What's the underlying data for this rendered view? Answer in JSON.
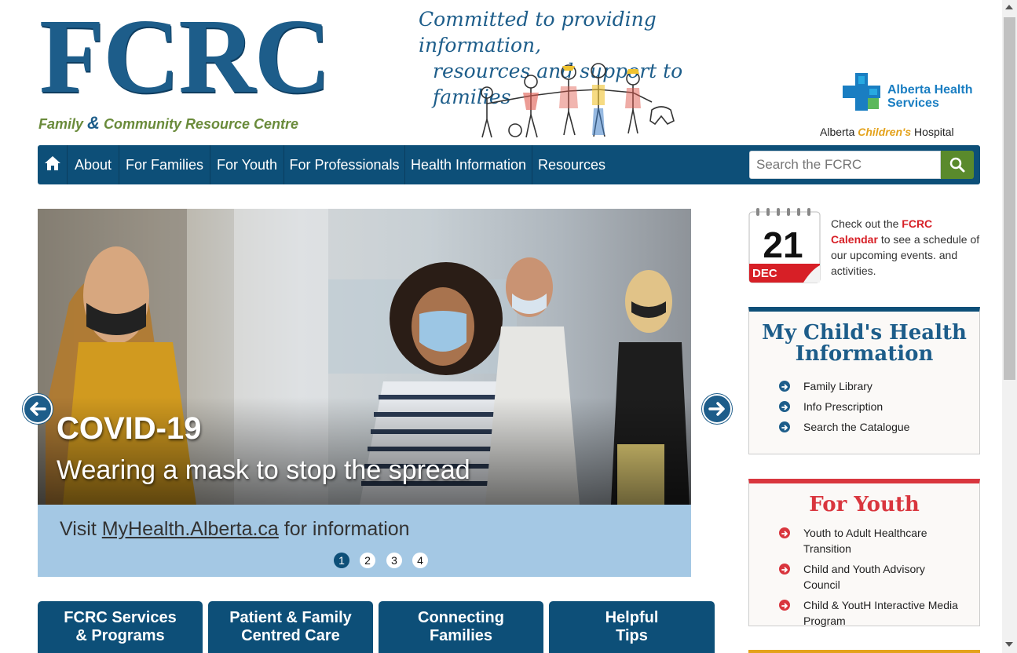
{
  "header": {
    "logo": "FCRC",
    "tagline_part1": "Family",
    "tagline_amp": "&",
    "tagline_part2": "Community Resource Centre",
    "slogan_line1": "Committed to providing information,",
    "slogan_line2": "resources and support to families",
    "ahs_line1": "Alberta Health",
    "ahs_line2": "Services",
    "ach_part1": "Alberta",
    "ach_part2": "Children's",
    "ach_part3": "Hospital"
  },
  "nav": {
    "home_icon": "home-icon",
    "items": [
      "About",
      "For Families",
      "For Youth",
      "For Professionals",
      "Health Information",
      "Resources"
    ],
    "search_placeholder": "Search the FCRC"
  },
  "carousel": {
    "title": "COVID-19",
    "subtitle": "Wearing a mask to stop the spread",
    "visit_prefix": "Visit",
    "visit_link": "MyHealth.Alberta.ca",
    "visit_suffix": "for information",
    "pages": [
      "1",
      "2",
      "3",
      "4"
    ],
    "active_page": 1
  },
  "tabs": [
    {
      "line1": "FCRC Services",
      "line2": "& Programs"
    },
    {
      "line1": "Patient & Family",
      "line2": "Centred Care"
    },
    {
      "line1": "Connecting",
      "line2": "Families"
    },
    {
      "line1": "Helpful",
      "line2": "Tips"
    }
  ],
  "calendar": {
    "day": "21",
    "month": "DEC",
    "text_prefix": "Check out the",
    "link_text": "FCRC Calendar",
    "text_suffix": "to see a schedule of our upcoming events. and activities."
  },
  "health_box": {
    "title_line1": "My Child's Health",
    "title_line2": "Information",
    "items": [
      "Family Library",
      "Info Prescription",
      "Search the Catalogue"
    ]
  },
  "youth_box": {
    "title": "For Youth",
    "items": [
      "Youth to Adult Healthcare Transition",
      "Child and Youth Advisory Council",
      "Child & YoutH Interactive Media Program"
    ]
  },
  "colors": {
    "navy": "#0d4f78",
    "brand_blue": "#1d5d8a",
    "green": "#5a8a2c",
    "red": "#d9363e",
    "band_blue": "#a4c8e4"
  }
}
